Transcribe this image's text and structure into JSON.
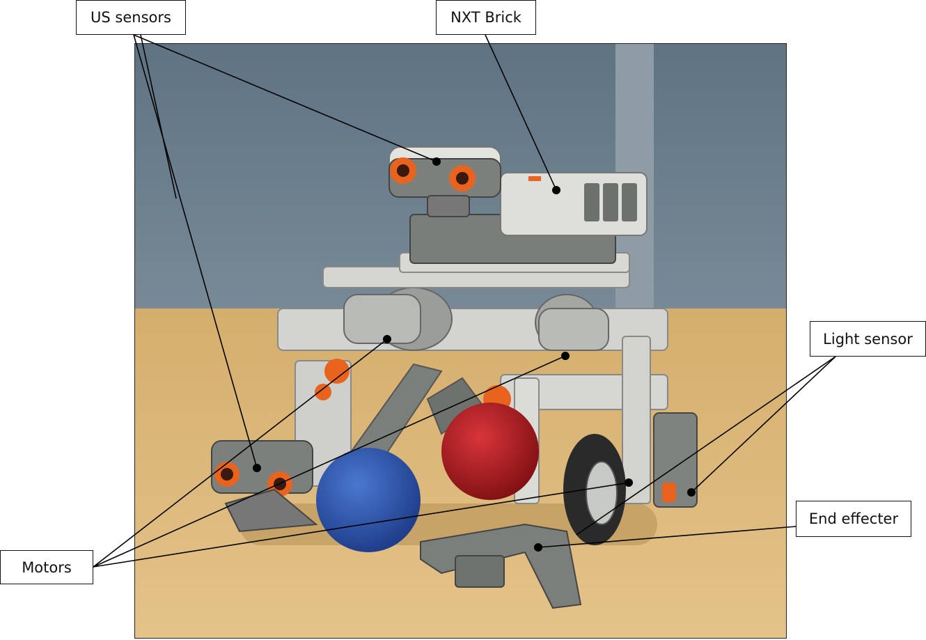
{
  "labels": {
    "us_sensors": "US sensors",
    "nxt_brick": "NXT Brick",
    "light_sensor": "Light sensor",
    "end_effecter": "End effecter",
    "motors": "Motors"
  },
  "colors": {
    "wall": "#6b7f8f",
    "table": "#d9b574",
    "lego_gray": "#8a8f8c",
    "lego_light": "#d7d8d2",
    "orange": "#e8641e",
    "blue_ball": "#2a4fa8",
    "red_ball": "#b0191a"
  }
}
